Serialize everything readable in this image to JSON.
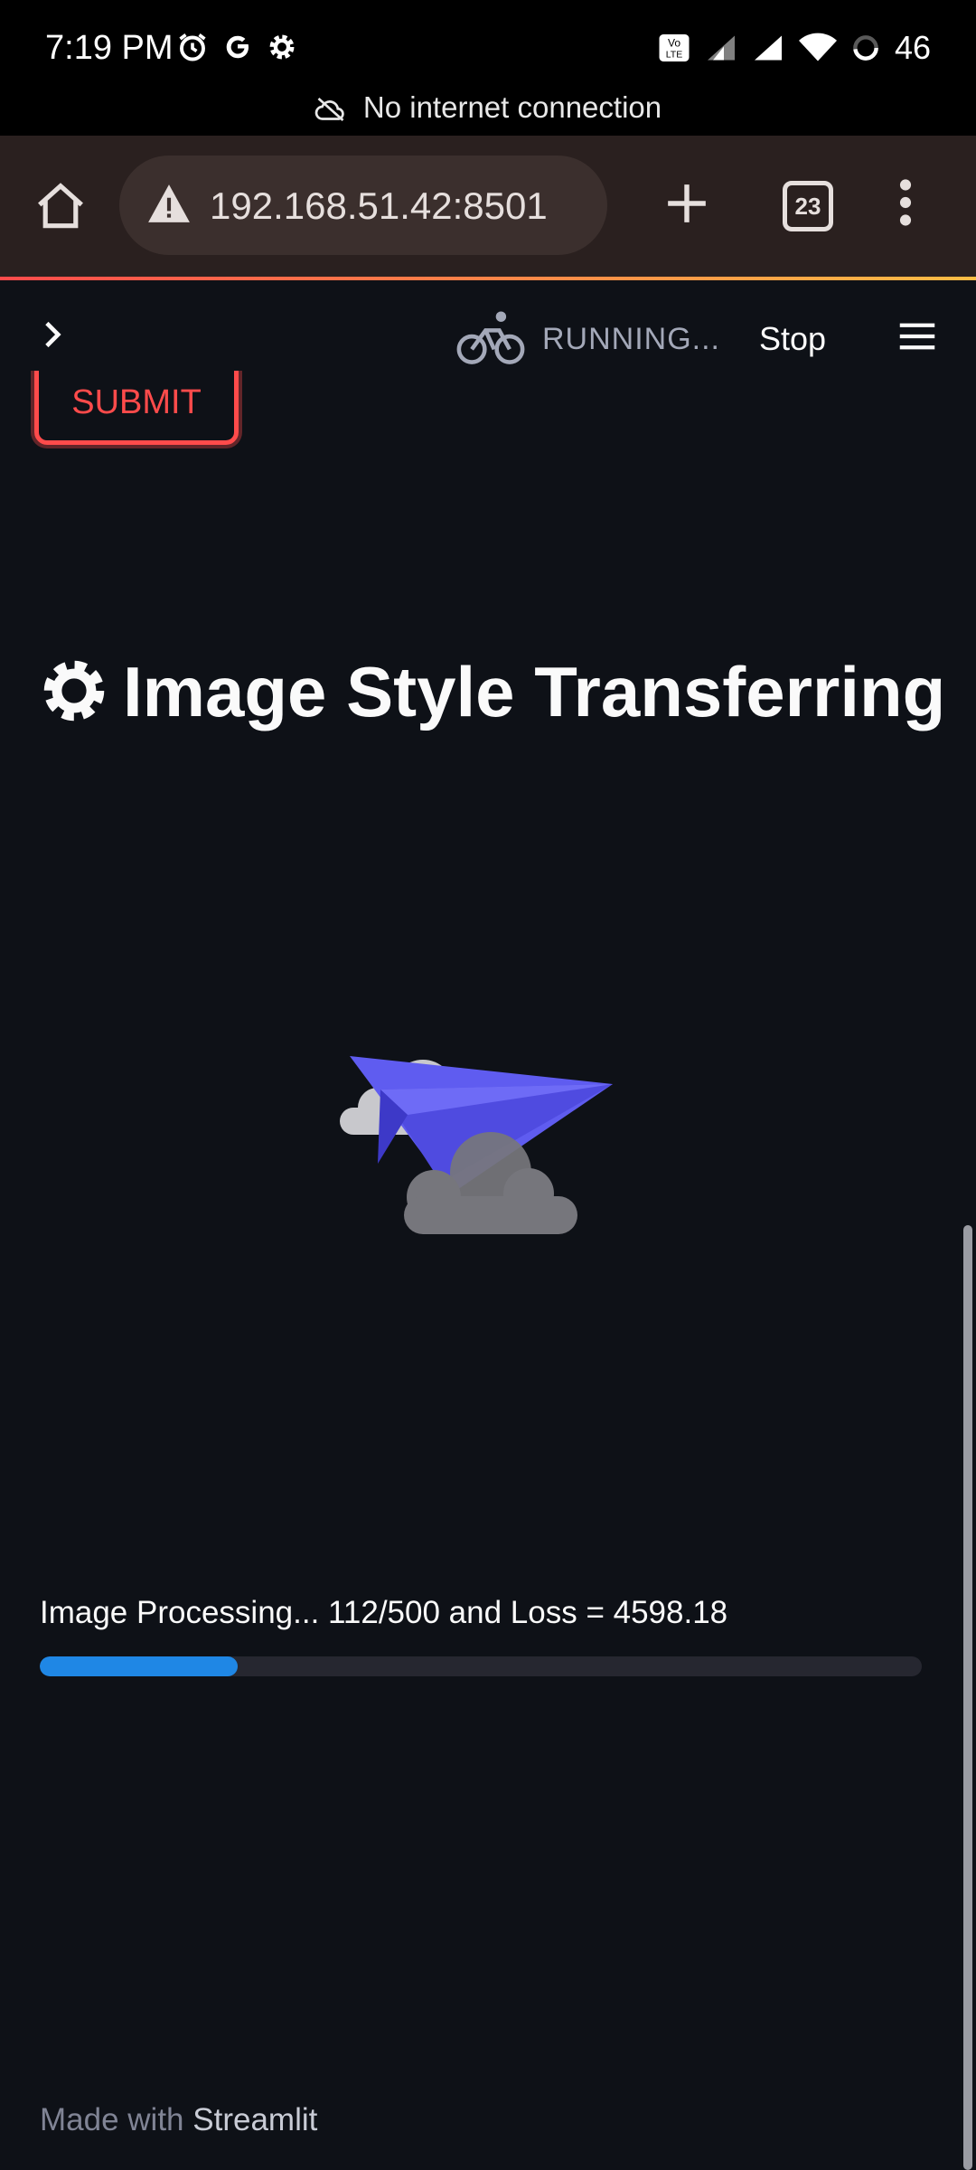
{
  "status_bar": {
    "time": "7:19 PM",
    "battery": "46",
    "network_message": "No internet connection",
    "left_icons": [
      "alarm-icon",
      "google-icon",
      "settings-icon"
    ],
    "right_icons": [
      "volte-icon",
      "signal-icon",
      "signal-icon",
      "wifi-icon",
      "battery-icon"
    ]
  },
  "browser": {
    "url": "192.168.51.42:8501",
    "tab_count": "23",
    "icons": [
      "home-icon",
      "warning-icon",
      "plus-icon",
      "tabs-icon",
      "more-vert-icon"
    ]
  },
  "app_header": {
    "status": "RUNNING...",
    "stop_label": "Stop",
    "icons": [
      "chevron-right-icon",
      "bicycle-icon",
      "hamburger-menu-icon"
    ]
  },
  "form": {
    "submit_label": "SUBMIT"
  },
  "page": {
    "title": "Image Style Transferring",
    "title_icon": "gear-icon",
    "illustration": "paper-plane-clouds"
  },
  "progress": {
    "label": "Image Processing... 112/500 and Loss = 4598.18",
    "current": 112,
    "total": 500,
    "fraction": 0.224
  },
  "footer": {
    "prefix": "Made with",
    "brand": "Streamlit"
  },
  "colors": {
    "background": "#0e1117",
    "accent": "#ff4b4b",
    "progress": "#1f87e5",
    "plane": "#5f5cf0"
  }
}
